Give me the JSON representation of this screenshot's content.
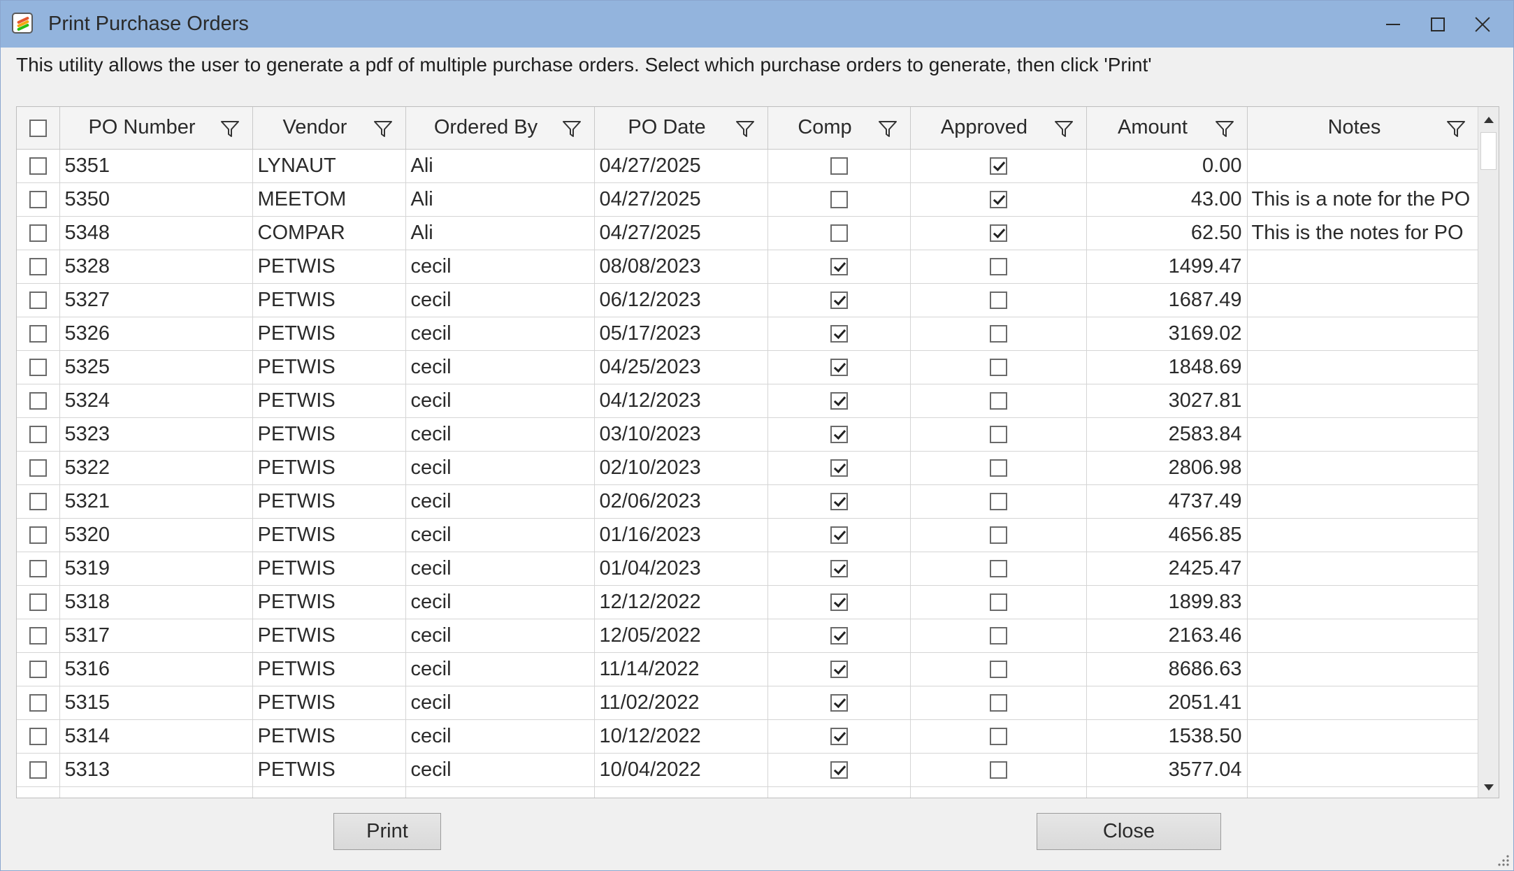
{
  "window": {
    "title": "Print Purchase Orders",
    "controls": {
      "minimize": "minimize-icon",
      "maximize": "maximize-icon",
      "close": "close-icon"
    }
  },
  "description": "This utility allows the user to generate a pdf of multiple purchase orders. Select which purchase orders to generate, then click 'Print'",
  "grid": {
    "columns": [
      "PO Number",
      "Vendor",
      "Ordered By",
      "PO Date",
      "Comp",
      "Approved",
      "Amount",
      "Notes"
    ],
    "select_all_checked": false,
    "rows": [
      {
        "selected": false,
        "po": "5351",
        "vendor": "LYNAUT",
        "ordered_by": "Ali",
        "date": "04/27/2025",
        "comp": false,
        "approved": true,
        "amount": "0.00",
        "notes": ""
      },
      {
        "selected": false,
        "po": "5350",
        "vendor": "MEETOM",
        "ordered_by": "Ali",
        "date": "04/27/2025",
        "comp": false,
        "approved": true,
        "amount": "43.00",
        "notes": "This is a note for the PO"
      },
      {
        "selected": false,
        "po": "5348",
        "vendor": "COMPAR",
        "ordered_by": "Ali",
        "date": "04/27/2025",
        "comp": false,
        "approved": true,
        "amount": "62.50",
        "notes": "This is the notes for PO"
      },
      {
        "selected": false,
        "po": "5328",
        "vendor": "PETWIS",
        "ordered_by": "cecil",
        "date": "08/08/2023",
        "comp": true,
        "approved": false,
        "amount": "1499.47",
        "notes": ""
      },
      {
        "selected": false,
        "po": "5327",
        "vendor": "PETWIS",
        "ordered_by": "cecil",
        "date": "06/12/2023",
        "comp": true,
        "approved": false,
        "amount": "1687.49",
        "notes": ""
      },
      {
        "selected": false,
        "po": "5326",
        "vendor": "PETWIS",
        "ordered_by": "cecil",
        "date": "05/17/2023",
        "comp": true,
        "approved": false,
        "amount": "3169.02",
        "notes": ""
      },
      {
        "selected": false,
        "po": "5325",
        "vendor": "PETWIS",
        "ordered_by": "cecil",
        "date": "04/25/2023",
        "comp": true,
        "approved": false,
        "amount": "1848.69",
        "notes": ""
      },
      {
        "selected": false,
        "po": "5324",
        "vendor": "PETWIS",
        "ordered_by": "cecil",
        "date": "04/12/2023",
        "comp": true,
        "approved": false,
        "amount": "3027.81",
        "notes": ""
      },
      {
        "selected": false,
        "po": "5323",
        "vendor": "PETWIS",
        "ordered_by": "cecil",
        "date": "03/10/2023",
        "comp": true,
        "approved": false,
        "amount": "2583.84",
        "notes": ""
      },
      {
        "selected": false,
        "po": "5322",
        "vendor": "PETWIS",
        "ordered_by": "cecil",
        "date": "02/10/2023",
        "comp": true,
        "approved": false,
        "amount": "2806.98",
        "notes": ""
      },
      {
        "selected": false,
        "po": "5321",
        "vendor": "PETWIS",
        "ordered_by": "cecil",
        "date": "02/06/2023",
        "comp": true,
        "approved": false,
        "amount": "4737.49",
        "notes": ""
      },
      {
        "selected": false,
        "po": "5320",
        "vendor": "PETWIS",
        "ordered_by": "cecil",
        "date": "01/16/2023",
        "comp": true,
        "approved": false,
        "amount": "4656.85",
        "notes": ""
      },
      {
        "selected": false,
        "po": "5319",
        "vendor": "PETWIS",
        "ordered_by": "cecil",
        "date": "01/04/2023",
        "comp": true,
        "approved": false,
        "amount": "2425.47",
        "notes": ""
      },
      {
        "selected": false,
        "po": "5318",
        "vendor": "PETWIS",
        "ordered_by": "cecil",
        "date": "12/12/2022",
        "comp": true,
        "approved": false,
        "amount": "1899.83",
        "notes": ""
      },
      {
        "selected": false,
        "po": "5317",
        "vendor": "PETWIS",
        "ordered_by": "cecil",
        "date": "12/05/2022",
        "comp": true,
        "approved": false,
        "amount": "2163.46",
        "notes": ""
      },
      {
        "selected": false,
        "po": "5316",
        "vendor": "PETWIS",
        "ordered_by": "cecil",
        "date": "11/14/2022",
        "comp": true,
        "approved": false,
        "amount": "8686.63",
        "notes": ""
      },
      {
        "selected": false,
        "po": "5315",
        "vendor": "PETWIS",
        "ordered_by": "cecil",
        "date": "11/02/2022",
        "comp": true,
        "approved": false,
        "amount": "2051.41",
        "notes": ""
      },
      {
        "selected": false,
        "po": "5314",
        "vendor": "PETWIS",
        "ordered_by": "cecil",
        "date": "10/12/2022",
        "comp": true,
        "approved": false,
        "amount": "1538.50",
        "notes": ""
      },
      {
        "selected": false,
        "po": "5313",
        "vendor": "PETWIS",
        "ordered_by": "cecil",
        "date": "10/04/2022",
        "comp": true,
        "approved": false,
        "amount": "3577.04",
        "notes": ""
      }
    ]
  },
  "buttons": {
    "print": "Print",
    "close": "Close"
  },
  "colors": {
    "titlebar": "#93b4dd",
    "window_bg": "#f0f0f0",
    "grid_bg": "#ffffff"
  }
}
